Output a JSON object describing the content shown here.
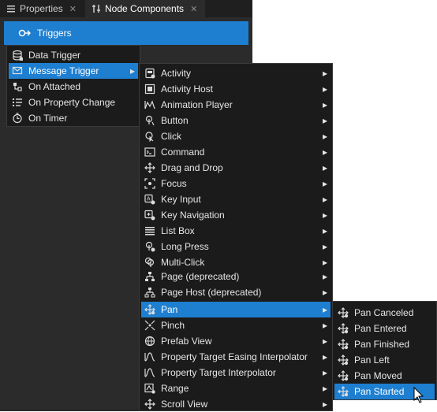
{
  "tabs": [
    {
      "label": "Properties",
      "close": "✕"
    },
    {
      "label": "Node Components",
      "close": "✕"
    }
  ],
  "triggers_button": {
    "label": "Triggers"
  },
  "menu1": [
    {
      "label": "Data Trigger",
      "icon": "database-icon"
    },
    {
      "label": "Message Trigger",
      "icon": "message-icon",
      "submenu": true,
      "selected": true
    },
    {
      "label": "On Attached",
      "icon": "attached-icon"
    },
    {
      "label": "On Property Change",
      "icon": "property-change-icon"
    },
    {
      "label": "On Timer",
      "icon": "timer-icon"
    }
  ],
  "menu2": [
    {
      "label": "Activity",
      "icon": "activity-icon"
    },
    {
      "label": "Activity Host",
      "icon": "activity-host-icon"
    },
    {
      "label": "Animation Player",
      "icon": "animation-player-icon"
    },
    {
      "label": "Button",
      "icon": "button-icon"
    },
    {
      "label": "Click",
      "icon": "click-icon"
    },
    {
      "label": "Command",
      "icon": "command-icon"
    },
    {
      "label": "Drag and Drop",
      "icon": "drag-drop-icon"
    },
    {
      "label": "Focus",
      "icon": "focus-icon"
    },
    {
      "label": "Key Input",
      "icon": "key-input-icon"
    },
    {
      "label": "Key Navigation",
      "icon": "key-navigation-icon"
    },
    {
      "label": "List Box",
      "icon": "list-box-icon"
    },
    {
      "label": "Long Press",
      "icon": "long-press-icon"
    },
    {
      "label": "Multi-Click",
      "icon": "multi-click-icon"
    },
    {
      "label": "Page (deprecated)",
      "icon": "page-icon"
    },
    {
      "label": "Page Host (deprecated)",
      "icon": "page-host-icon"
    },
    {
      "label": "Pan",
      "icon": "pan-icon",
      "selected": true
    },
    {
      "label": "Pinch",
      "icon": "pinch-icon"
    },
    {
      "label": "Prefab View",
      "icon": "prefab-view-icon"
    },
    {
      "label": "Property Target Easing Interpolator",
      "icon": "interpolator-icon"
    },
    {
      "label": "Property Target Interpolator",
      "icon": "interpolator-icon"
    },
    {
      "label": "Range",
      "icon": "range-icon"
    },
    {
      "label": "Scroll View",
      "icon": "scroll-view-icon"
    }
  ],
  "menu3": [
    {
      "label": "Pan Canceled",
      "icon": "pan-icon"
    },
    {
      "label": "Pan Entered",
      "icon": "pan-icon"
    },
    {
      "label": "Pan Finished",
      "icon": "pan-icon"
    },
    {
      "label": "Pan Left",
      "icon": "pan-icon"
    },
    {
      "label": "Pan Moved",
      "icon": "pan-icon"
    },
    {
      "label": "Pan Started",
      "icon": "pan-icon",
      "selected": true
    }
  ],
  "submenu_arrow": "▸",
  "colors": {
    "accent": "#1e7fd1",
    "menu_bg": "#1b1b1b",
    "panel_bg": "#2b2b2b"
  }
}
